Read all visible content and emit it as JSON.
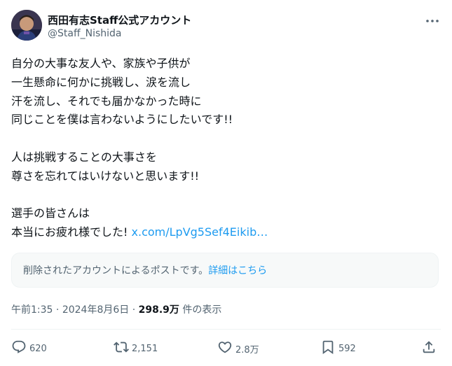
{
  "author": {
    "display_name": "西田有志Staff公式アカウント",
    "handle": "@Staff_Nishida"
  },
  "post": {
    "lines": [
      "自分の大事な友人や、家族や子供が",
      "一生懸命に何かに挑戦し、涙を流し",
      "汗を流し、それでも届かなかった時に",
      "同じことを僕は言わないようにしたいです!!",
      "",
      "人は挑戦することの大事さを",
      "尊さを忘れてはいけないと思います!!",
      "",
      "選手の皆さんは"
    ],
    "last_line_text": "本当にお疲れ様でした! ",
    "link_text": "x.com/LpVg5Sef4Eikib…"
  },
  "quoted": {
    "deleted_text": "削除されたアカウントによるポストです。",
    "details_link": "詳細はこちら"
  },
  "meta": {
    "time": "午前1:35",
    "separator1": " · ",
    "date": "2024年8月6日",
    "separator2": " · ",
    "views_count": "298.9万",
    "views_label": " 件の表示"
  },
  "actions": {
    "reply_count": "620",
    "repost_count": "2,151",
    "like_count": "2.8万",
    "bookmark_count": "592"
  },
  "icons": {
    "more": "more-icon",
    "reply": "reply-icon",
    "repost": "repost-icon",
    "like": "like-icon",
    "bookmark": "bookmark-icon",
    "share": "share-icon"
  },
  "colors": {
    "text": "#0f1419",
    "secondary": "#536471",
    "link": "#1d9bf0",
    "quote_bg": "#f7f9f9"
  }
}
